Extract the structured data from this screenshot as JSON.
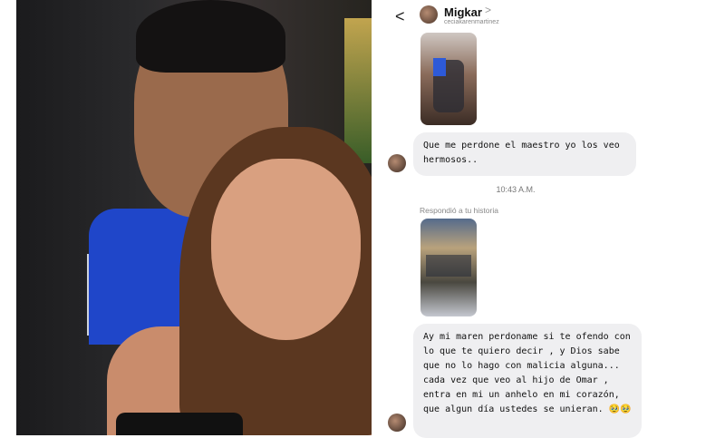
{
  "chat": {
    "header": {
      "name": "Migkar",
      "username": "ceciakarenmartinez",
      "chevron": ">",
      "back": "<"
    },
    "messages": [
      {
        "type": "story_reply_thumbnail",
        "index": 1
      },
      {
        "type": "text",
        "text": "Que me perdone el maestro yo los veo hermosos.."
      },
      {
        "type": "timestamp",
        "text": "10:43 A.M."
      },
      {
        "type": "reply_label",
        "text": "Respondió a tu historia"
      },
      {
        "type": "story_reply_thumbnail",
        "index": 2
      },
      {
        "type": "text",
        "text": "Ay mi maren perdoname si te ofendo con lo que te quiero decir , y Dios sabe que no lo hago con malicia alguna... cada vez que veo al hijo de Omar , entra en mi un anhelo en mi corazón, que algun día ustedes se unieran. 🥹🥹"
      }
    ]
  },
  "icons": [
    "back-icon",
    "chevron-right-icon",
    "avatar-icon"
  ]
}
